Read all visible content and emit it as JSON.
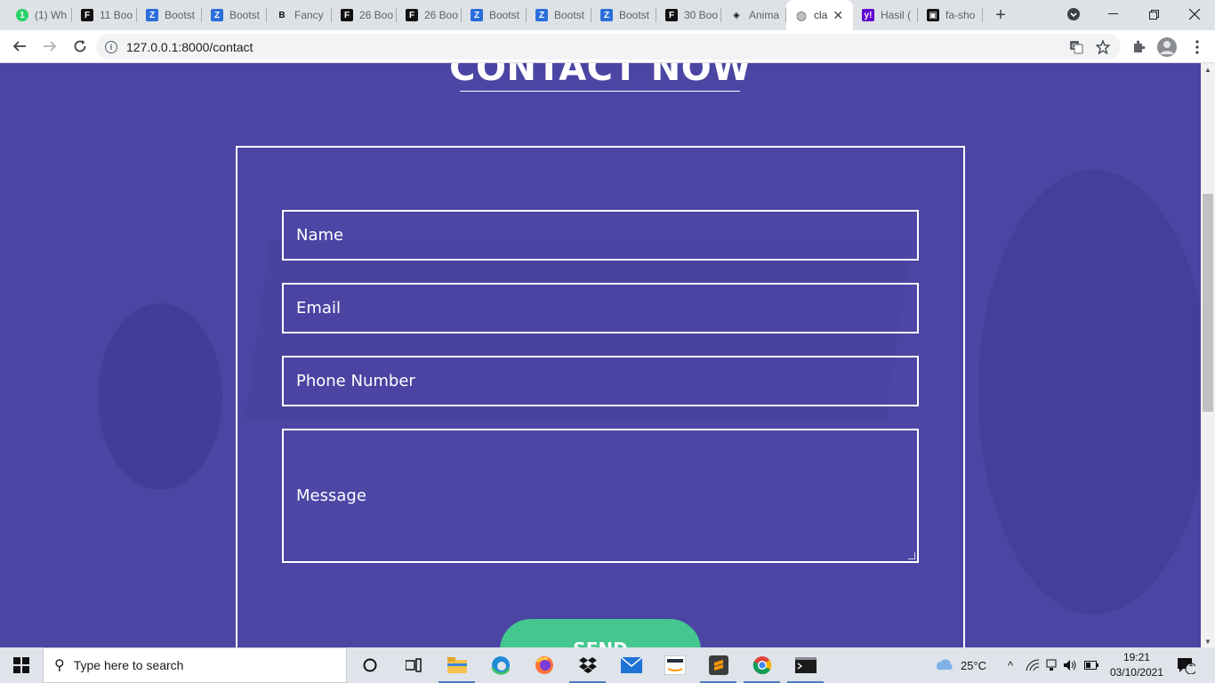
{
  "browser": {
    "tabs": [
      {
        "label": "(1) Wh",
        "icon": "whatsapp-icon",
        "color": "#25d366"
      },
      {
        "label": "11 Boo",
        "icon": "frontendor-icon",
        "color": "#111111"
      },
      {
        "label": "Bootst",
        "icon": "bootstrap-icon",
        "color": "#2a6edb"
      },
      {
        "label": "Bootst",
        "icon": "bootstrap-icon",
        "color": "#2a6edb"
      },
      {
        "label": "Fancy",
        "icon": "fancy-b-icon",
        "color": "#111111"
      },
      {
        "label": "26 Boo",
        "icon": "frontendor-icon",
        "color": "#111111"
      },
      {
        "label": "26 Boo",
        "icon": "frontendor-icon",
        "color": "#111111"
      },
      {
        "label": "Bootst",
        "icon": "bootstrap-icon",
        "color": "#2a6edb"
      },
      {
        "label": "Bootst",
        "icon": "bootstrap-icon",
        "color": "#2a6edb"
      },
      {
        "label": "Bootst",
        "icon": "bootstrap-icon",
        "color": "#2a6edb"
      },
      {
        "label": "30 Boo",
        "icon": "frontendor-icon",
        "color": "#111111"
      },
      {
        "label": "Anima",
        "icon": "codepen-icon",
        "color": "#111111"
      },
      {
        "label": "cla",
        "icon": "globe-icon",
        "color": "#5f6368",
        "active": true
      },
      {
        "label": "Hasil (",
        "icon": "yahoo-icon",
        "color": "#6001d2"
      },
      {
        "label": "fa-sho",
        "icon": "folder-icon",
        "color": "#111111"
      }
    ],
    "new_tab": "+",
    "url": "127.0.0.1:8000/contact",
    "active_tab_close": "✕"
  },
  "page": {
    "heading": "CONTACT NOW",
    "fields": {
      "name": "Name",
      "email": "Email",
      "phone": "Phone Number",
      "message": "Message"
    },
    "send_label": "SEND",
    "colors": {
      "background": "#4b45a3",
      "button": "#44c78e",
      "text": "#ffffff"
    }
  },
  "taskbar": {
    "search_placeholder": "Type here to search",
    "weather": "25°C",
    "time": "19:21",
    "date": "03/10/2021",
    "notification_count": "1"
  }
}
